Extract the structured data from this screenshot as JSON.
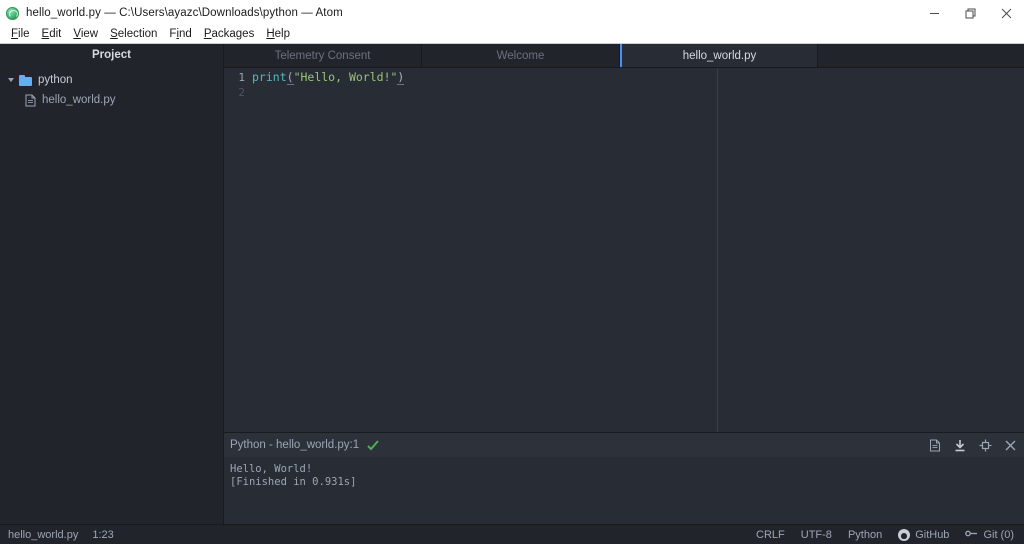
{
  "window": {
    "title": "hello_world.py — C:\\Users\\ayazc\\Downloads\\python — Atom",
    "logo_icon": "atom-logo-icon",
    "controls": [
      {
        "name": "minimize-button",
        "icon": "minimize-icon"
      },
      {
        "name": "restore-button",
        "icon": "restore-icon"
      },
      {
        "name": "close-button",
        "icon": "close-icon"
      }
    ]
  },
  "menubar": {
    "items": [
      {
        "label": "File",
        "accesskey": "F"
      },
      {
        "label": "Edit",
        "accesskey": "E"
      },
      {
        "label": "View",
        "accesskey": "V"
      },
      {
        "label": "Selection",
        "accesskey": "S"
      },
      {
        "label": "Find",
        "accesskey": "i"
      },
      {
        "label": "Packages",
        "accesskey": "P"
      },
      {
        "label": "Help",
        "accesskey": "H"
      }
    ]
  },
  "sidebar": {
    "header": "Project",
    "tree": [
      {
        "label": "python",
        "type": "folder",
        "icon": "folder-icon",
        "expanded": true
      },
      {
        "label": "hello_world.py",
        "type": "file",
        "icon": "file-icon"
      }
    ]
  },
  "tabs": [
    {
      "label": "Telemetry Consent",
      "active": false
    },
    {
      "label": "Welcome",
      "active": false
    },
    {
      "label": "hello_world.py",
      "active": true
    }
  ],
  "editor": {
    "lines": [
      {
        "number": "1",
        "active": true,
        "tokens": [
          {
            "text": "print",
            "type": "function"
          },
          {
            "text": "(",
            "type": "punct"
          },
          {
            "text": "\"Hello, World!\"",
            "type": "string"
          },
          {
            "text": ")",
            "type": "punct"
          }
        ]
      },
      {
        "number": "2",
        "active": false,
        "tokens": []
      }
    ]
  },
  "panel": {
    "title": "Python - hello_world.py:1",
    "status_icon": "green-check-icon",
    "actions": [
      {
        "name": "copy-output-button",
        "icon": "file-copy-icon"
      },
      {
        "name": "save-output-button",
        "icon": "download-icon"
      },
      {
        "name": "split-pane-button",
        "icon": "split-icon"
      },
      {
        "name": "close-panel-button",
        "icon": "close-icon"
      }
    ],
    "output": "Hello, World!\n[Finished in 0.931s]"
  },
  "statusbar": {
    "left": [
      {
        "name": "active-file-name",
        "label": "hello_world.py"
      },
      {
        "name": "cursor-position",
        "label": "1:23"
      }
    ],
    "right": [
      {
        "name": "line-ending",
        "label": "CRLF",
        "icon": null
      },
      {
        "name": "file-encoding",
        "label": "UTF-8",
        "icon": null
      },
      {
        "name": "grammar-selector",
        "label": "Python",
        "icon": null
      },
      {
        "name": "github-status",
        "label": "GitHub",
        "icon": "octocat-icon"
      },
      {
        "name": "git-status",
        "label": "Git (0)",
        "icon": "git-branch-icon"
      }
    ]
  },
  "colors": {
    "editor_bg": "#282c34",
    "sidebar_bg": "#21252b",
    "accent": "#4d8ef7",
    "string": "#98c379",
    "function": "#56b6c2",
    "success": "#4caf50"
  }
}
